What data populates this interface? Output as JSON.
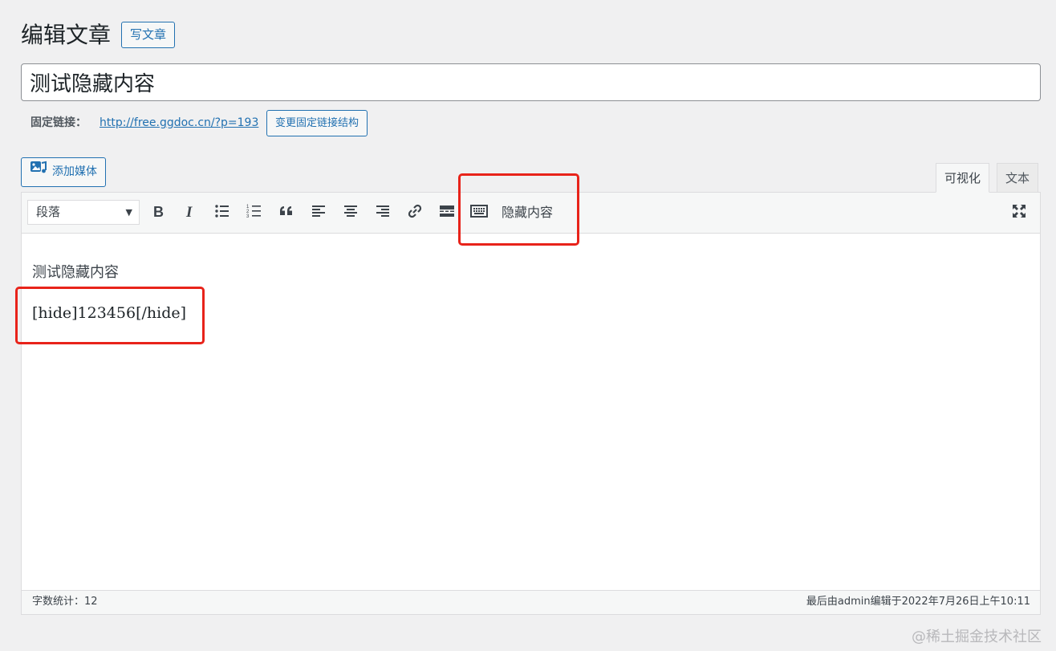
{
  "header": {
    "title": "编辑文章",
    "new_post_label": "写文章"
  },
  "post": {
    "title": "测试隐藏内容"
  },
  "permalink": {
    "label": "固定链接：",
    "url": "http://free.ggdoc.cn/?p=193",
    "edit_label": "变更固定链接结构"
  },
  "media": {
    "add_label": "添加媒体"
  },
  "tabs": {
    "visual": "可视化",
    "text": "文本"
  },
  "toolbar": {
    "format_value": "段落",
    "hide_button_label": "隐藏内容",
    "icons": [
      "bold-icon",
      "italic-icon",
      "bullet-list-icon",
      "numbered-list-icon",
      "blockquote-icon",
      "align-left-icon",
      "align-center-icon",
      "align-right-icon",
      "link-icon",
      "read-more-icon",
      "keyboard-icon",
      "fullscreen-icon"
    ]
  },
  "content": {
    "paragraphs": [
      "测试隐藏内容",
      "[hide]123456[/hide]"
    ]
  },
  "status": {
    "word_count": "字数统计：12",
    "last_edit": "最后由admin编辑于2022年7月26日上午10:11"
  },
  "watermark": "@稀土掘金技术社区",
  "colors": {
    "accent": "#2271b1",
    "annotation": "#e8231a"
  }
}
